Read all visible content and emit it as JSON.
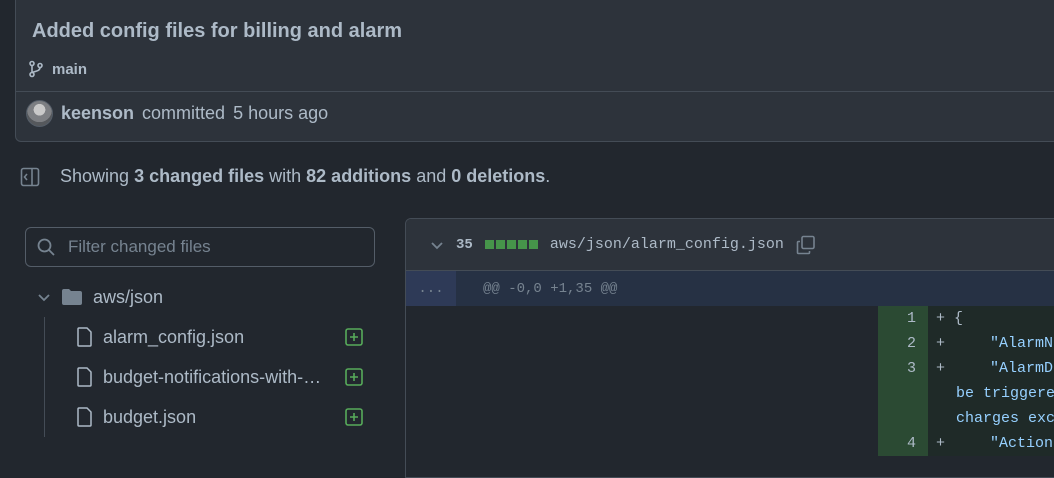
{
  "commit": {
    "title": "Added config files for billing and alarm",
    "branch": "main",
    "author": "keenson",
    "action": "committed",
    "time": "5 hours ago"
  },
  "summary": {
    "prefix": "Showing",
    "files": "3 changed files",
    "with": "with",
    "additions": "82 additions",
    "and": "and",
    "deletions": "0 deletions",
    "end": "."
  },
  "filter": {
    "placeholder": "Filter changed files"
  },
  "tree": {
    "folder": "aws/json",
    "files": [
      {
        "name": "alarm_config.json"
      },
      {
        "name": "budget-notifications-with-s…"
      },
      {
        "name": "budget.json"
      }
    ]
  },
  "diff": {
    "count": "35",
    "path": "aws/json/alarm_config.json",
    "hunk_dots": "...",
    "hunk_header": "@@ -0,0 +1,35 @@",
    "lines": [
      {
        "num": "1",
        "sign": "+",
        "code": "{"
      },
      {
        "num": "2",
        "sign": "+",
        "code": "    \"AlarmN"
      },
      {
        "num": "3",
        "sign": "+",
        "code": "    \"AlarmD",
        "cont1": "be triggere",
        "cont2": "charges exc"
      },
      {
        "num": "4",
        "sign": "+",
        "code": "    \"Action"
      }
    ]
  },
  "colors": {
    "bg": "#22272e",
    "added": "#46954a",
    "accent_text": "#96d0ff"
  }
}
